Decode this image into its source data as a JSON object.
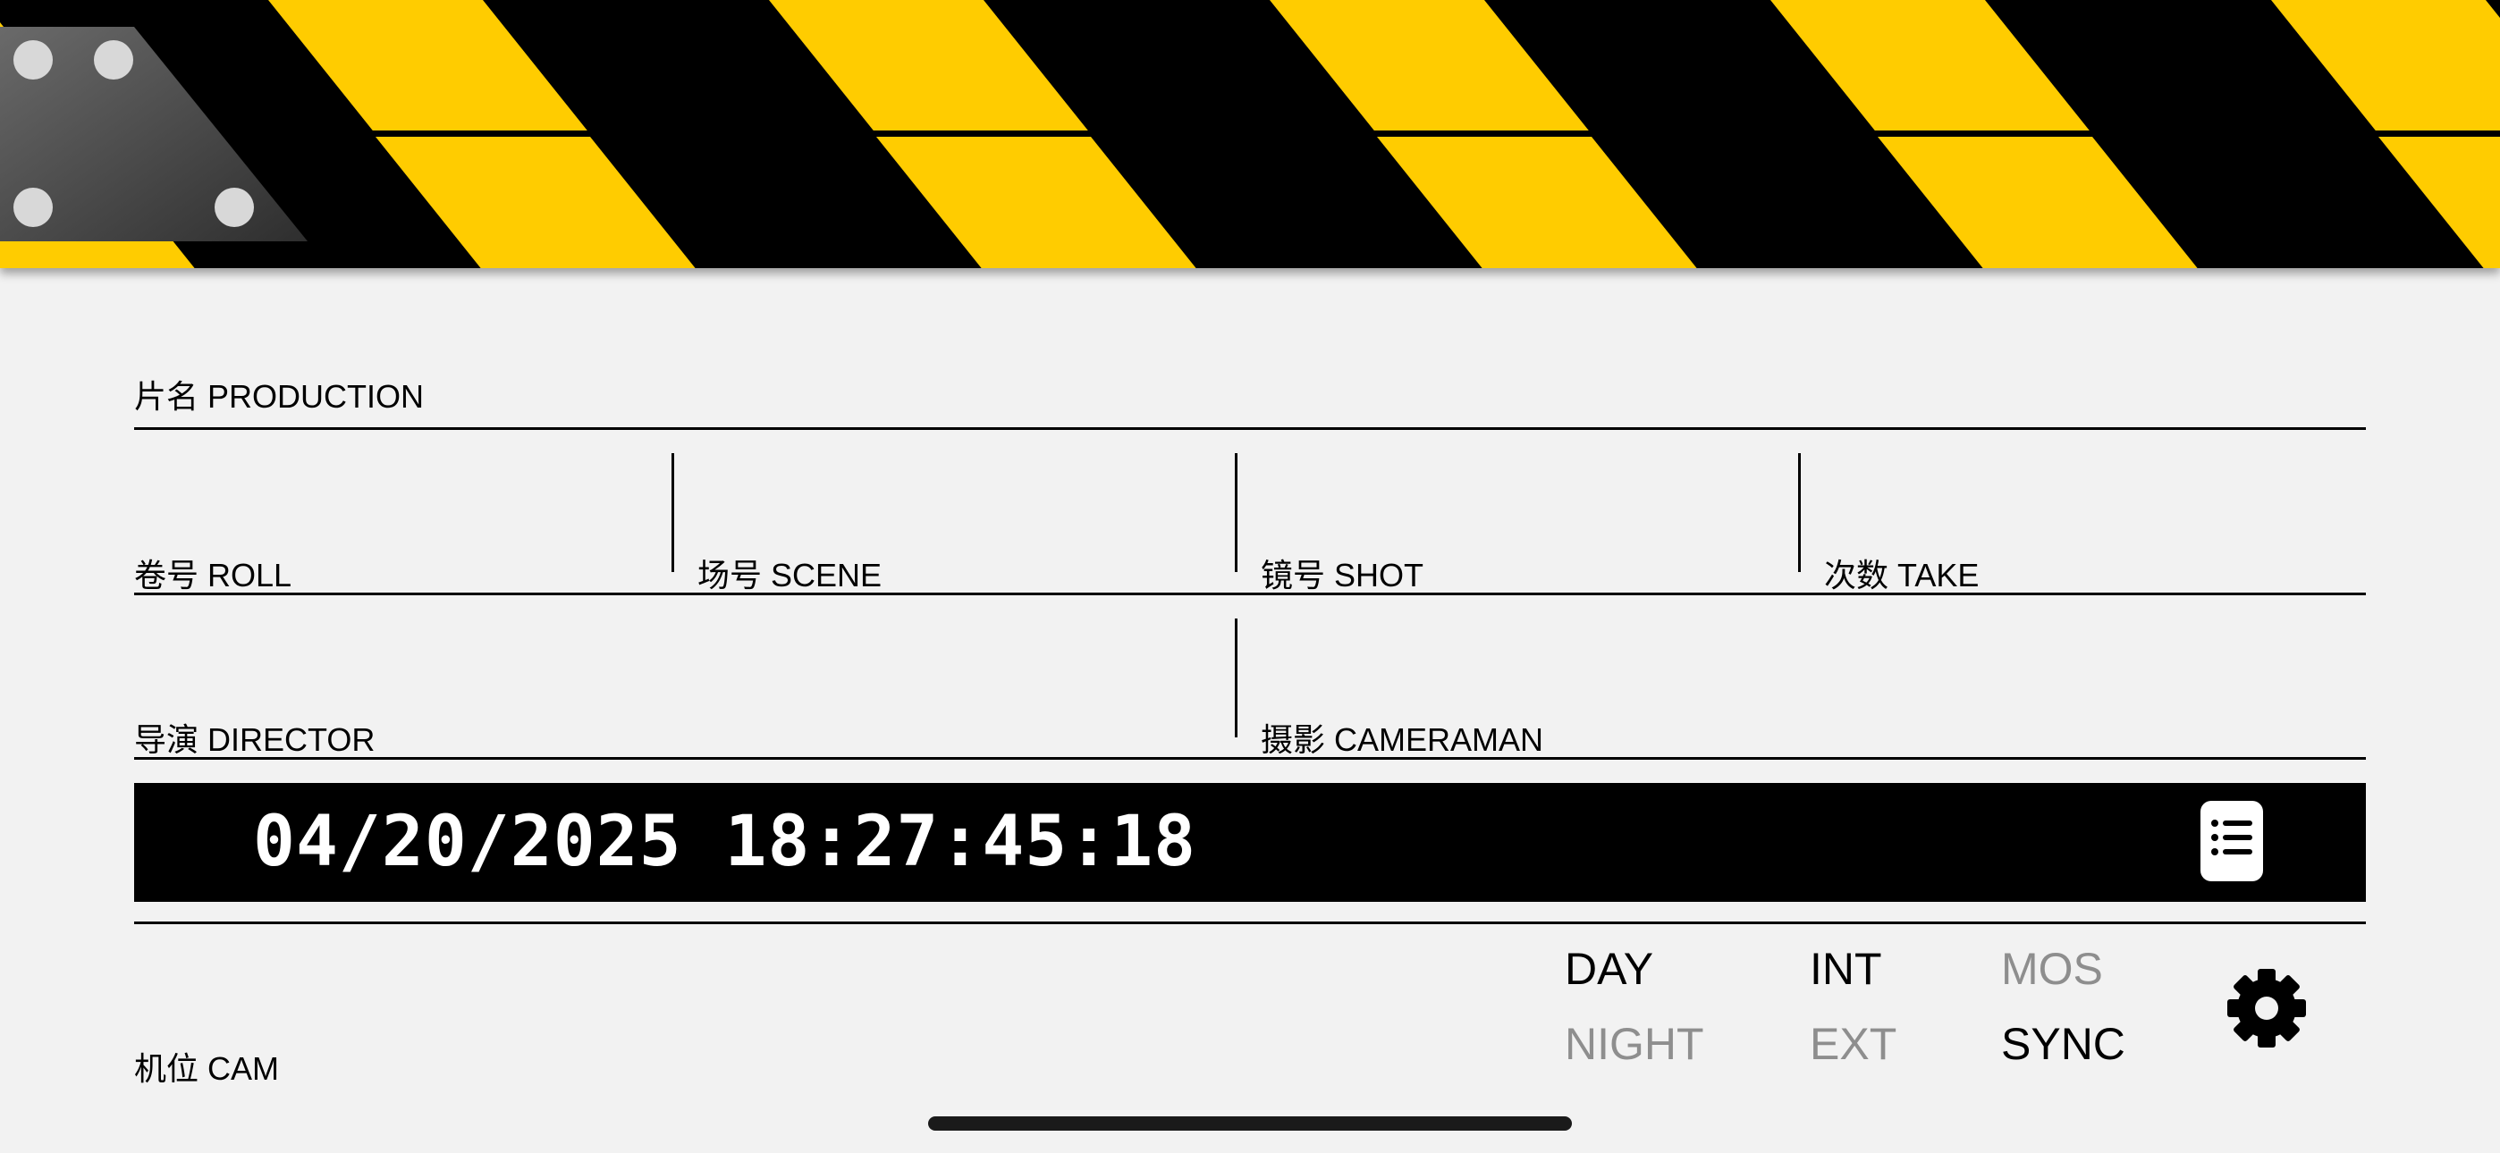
{
  "colors": {
    "stripe_yellow": "#ffcc00",
    "stripe_black": "#000000",
    "hinge_gray": "#4a4a4a",
    "background": "#f2f2f2",
    "inactive_text": "#8e8e8e"
  },
  "slate": {
    "production_label": "片名 PRODUCTION",
    "roll_label": "卷号 ROLL",
    "scene_label": "场号 SCENE",
    "shot_label": "镜号 SHOT",
    "take_label": "次数 TAKE",
    "director_label": "导演 DIRECTOR",
    "cameraman_label": "摄影 CAMERAMAN",
    "cam_label": "机位 CAM"
  },
  "timecode": {
    "value": "04/20/2025 18:27:45:18",
    "list_icon": "list-icon"
  },
  "toggles": {
    "day": {
      "label": "DAY",
      "active": true
    },
    "night": {
      "label": "NIGHT",
      "active": false
    },
    "int": {
      "label": "INT",
      "active": true
    },
    "ext": {
      "label": "EXT",
      "active": false
    },
    "mos": {
      "label": "MOS",
      "active": false
    },
    "sync": {
      "label": "SYNC",
      "active": true
    }
  },
  "settings_icon": "gear-icon"
}
